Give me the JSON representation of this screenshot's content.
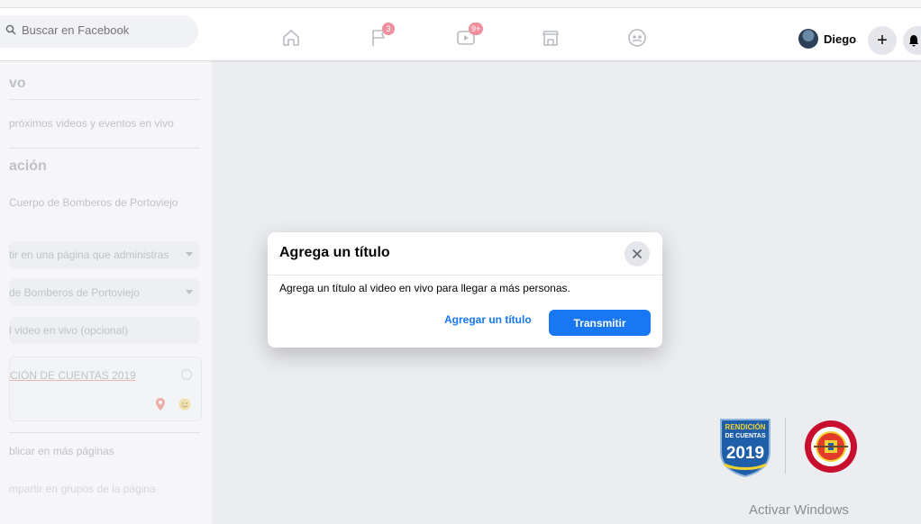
{
  "topbar": {
    "search_placeholder": "Buscar en Facebook",
    "nav": {
      "pages_badge": "3",
      "watch_badge": "9+"
    },
    "profile_name": "Diego",
    "create_label": "+"
  },
  "sidebar": {
    "heading_1": "vo",
    "text_1": "próximos videos y eventos en vivo",
    "heading_2": "ación",
    "text_2": "Cuerpo de Bomberos de Portoviejo",
    "dropdown_1": "tir en una página que administras",
    "dropdown_2": "de Bomberos de Portoviejo",
    "title_input": "l video en vivo (opcional)",
    "card_text": "CIÓN DE CUENTAS 2019",
    "more_pages": "blicar en más páginas",
    "groups_text": "mpartir en grupos de la página"
  },
  "dialog": {
    "title": "Agrega un título",
    "body": "Agrega un título al video en vivo para llegar a más personas.",
    "add_title_label": "Agregar un título",
    "stream_label": "Transmitir"
  },
  "logos": {
    "shield_line1": "RENDICIÓN",
    "shield_line2": "DE CUENTAS",
    "shield_year": "2019"
  },
  "watermark": "Activar Windows",
  "colors": {
    "accent": "#1877f2",
    "badge": "#f0909d",
    "shield_blue": "#1f5ea8",
    "seal_red": "#c8102e"
  },
  "icons": [
    "search-icon",
    "home-icon",
    "flag-icon",
    "video-icon",
    "store-icon",
    "groups-icon",
    "plus-icon",
    "bell-icon",
    "close-icon",
    "location-icon",
    "emoji-icon"
  ]
}
